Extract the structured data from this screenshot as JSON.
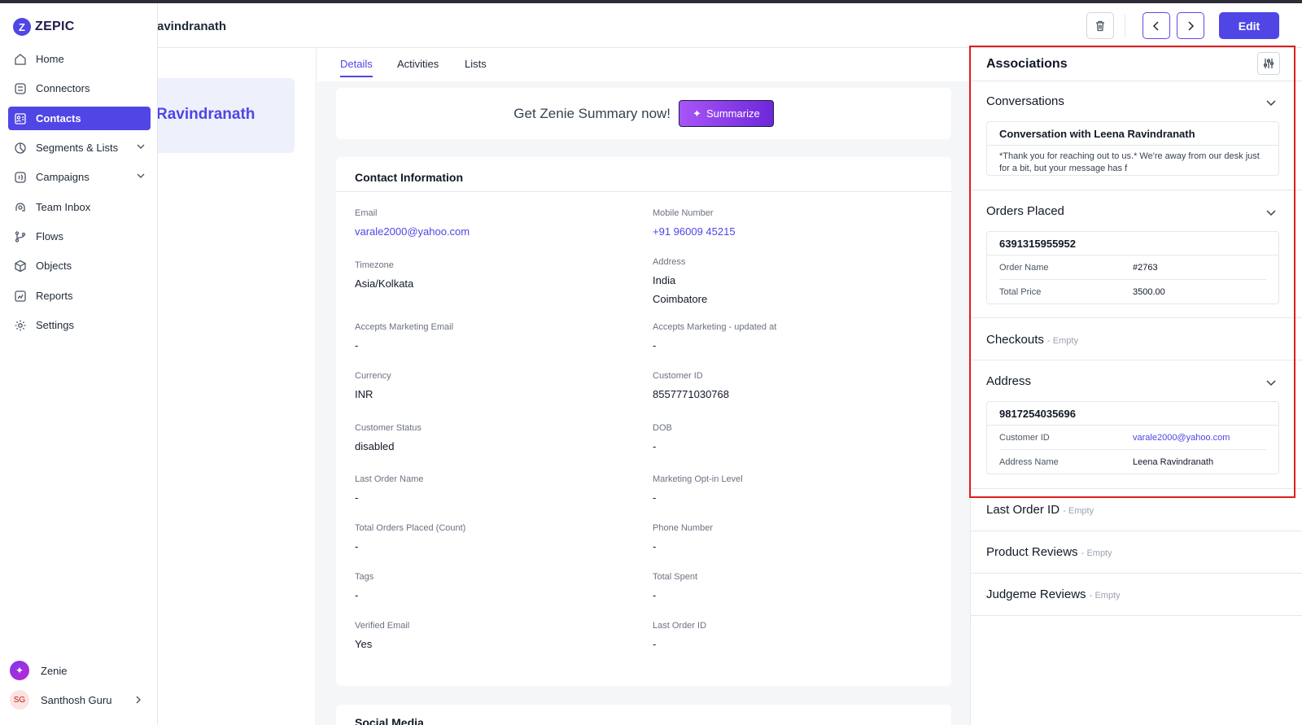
{
  "app": {
    "logo_letter": "Z",
    "logo_text": "ZEPIC"
  },
  "header": {
    "contact_name": "avindranath",
    "edit_label": "Edit",
    "delete_icon": "trash-icon",
    "prev_icon": "chevron-left-icon",
    "next_icon": "chevron-right-icon"
  },
  "sidebar": {
    "items": [
      {
        "label": "Home",
        "icon": "home-icon"
      },
      {
        "label": "Connectors",
        "icon": "connectors-icon"
      },
      {
        "label": "Contacts",
        "icon": "contacts-icon",
        "active": true
      },
      {
        "label": "Segments & Lists",
        "icon": "segments-icon",
        "expandable": true
      },
      {
        "label": "Campaigns",
        "icon": "campaigns-icon",
        "expandable": true
      },
      {
        "label": "Team Inbox",
        "icon": "inbox-icon"
      },
      {
        "label": "Flows",
        "icon": "flows-icon"
      },
      {
        "label": "Objects",
        "icon": "objects-icon"
      },
      {
        "label": "Reports",
        "icon": "reports-icon"
      },
      {
        "label": "Settings",
        "icon": "settings-icon"
      }
    ],
    "zenie_label": "Zenie",
    "user_initials": "SG",
    "user_name": "Santhosh Guru"
  },
  "profile": {
    "name": "Ravindranath"
  },
  "tabs": [
    {
      "label": "Details",
      "active": true
    },
    {
      "label": "Activities"
    },
    {
      "label": "Lists"
    }
  ],
  "summary": {
    "text": "Get Zenie Summary now!",
    "button_label": "Summarize"
  },
  "contact_info": {
    "title": "Contact Information",
    "fields": {
      "email": {
        "label": "Email",
        "value": "varale2000@yahoo.com"
      },
      "mobile": {
        "label": "Mobile Number",
        "value": "+91 96009 45215"
      },
      "timezone": {
        "label": "Timezone",
        "value": "Asia/Kolkata"
      },
      "address": {
        "label": "Address",
        "value": "India",
        "value2": "Coimbatore"
      },
      "accepts_marketing_email": {
        "label": "Accepts Marketing Email",
        "value": "-"
      },
      "accepts_marketing_updated": {
        "label": "Accepts Marketing - updated at",
        "value": "-"
      },
      "currency": {
        "label": "Currency",
        "value": "INR"
      },
      "customer_id": {
        "label": "Customer ID",
        "value": "8557771030768"
      },
      "customer_status": {
        "label": "Customer Status",
        "value": "disabled"
      },
      "dob": {
        "label": "DOB",
        "value": "-"
      },
      "last_order_name": {
        "label": "Last Order Name",
        "value": "-"
      },
      "marketing_optin": {
        "label": "Marketing Opt-in Level",
        "value": "-"
      },
      "total_orders": {
        "label": "Total Orders Placed (Count)",
        "value": "-"
      },
      "phone": {
        "label": "Phone Number",
        "value": "-"
      },
      "tags": {
        "label": "Tags",
        "value": "-"
      },
      "total_spent": {
        "label": "Total Spent",
        "value": "-"
      },
      "verified_email": {
        "label": "Verified Email",
        "value": "Yes"
      },
      "last_order_id": {
        "label": "Last Order ID",
        "value": "-"
      }
    }
  },
  "social": {
    "title": "Social Media"
  },
  "associations": {
    "title": "Associations",
    "conversations": {
      "title": "Conversations",
      "card_title": "Conversation with Leena Ravindranath",
      "card_body": "*Thank you for reaching out to us.* We're away from our desk just for a bit, but your message has f"
    },
    "orders": {
      "title": "Orders Placed",
      "card_title": "6391315955952",
      "rows": [
        {
          "k": "Order Name",
          "v": "#2763"
        },
        {
          "k": "Total Price",
          "v": "3500.00"
        }
      ]
    },
    "checkouts": {
      "title": "Checkouts",
      "empty": "- Empty"
    },
    "address": {
      "title": "Address",
      "card_title": "9817254035696",
      "rows": [
        {
          "k": "Customer ID",
          "v": "varale2000@yahoo.com"
        },
        {
          "k": "Address Name",
          "v": "Leena Ravindranath"
        }
      ]
    },
    "last_order_id": {
      "title": "Last Order ID",
      "empty": "- Empty"
    },
    "product_reviews": {
      "title": "Product Reviews",
      "empty": "- Empty"
    },
    "judgeme_reviews": {
      "title": "Judgeme Reviews",
      "empty": "- Empty"
    }
  },
  "colors": {
    "accent": "#4f46e5",
    "highlight": "#e11d1d"
  }
}
